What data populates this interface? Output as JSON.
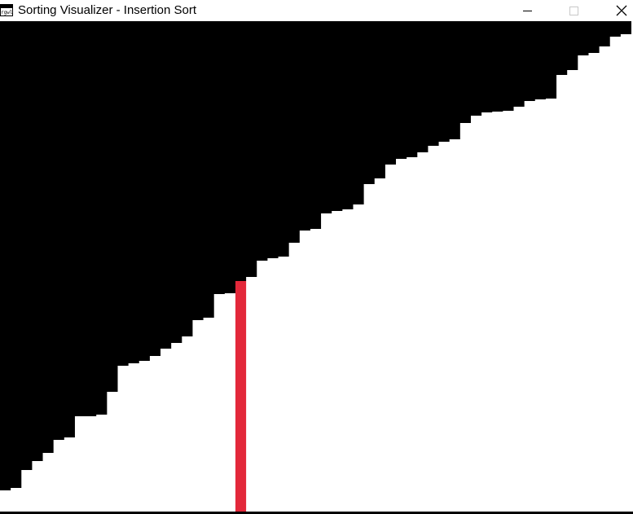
{
  "window": {
    "title": "Sorting Visualizer - Insertion Sort",
    "icon": "app-icon",
    "icon_text": "rgwlt",
    "controls": {
      "minimize": "minimize-icon",
      "maximize": "maximize-icon",
      "close": "close-icon",
      "close_glyph": "✕"
    }
  },
  "colors": {
    "background": "#000000",
    "bar": "#ffffff",
    "highlight": "#e3283a"
  },
  "visualizer": {
    "algorithm": "Insertion Sort",
    "max_value": 603,
    "current_index": 22,
    "values": [
      27,
      30,
      52,
      63,
      73,
      89,
      92,
      118,
      118,
      120,
      148,
      180,
      183,
      186,
      192,
      201,
      208,
      216,
      236,
      239,
      268,
      269,
      284,
      289,
      309,
      312,
      314,
      331,
      346,
      348,
      367,
      370,
      372,
      378,
      403,
      410,
      427,
      434,
      436,
      442,
      450,
      455,
      458,
      478,
      487,
      491,
      492,
      493,
      498,
      505,
      507,
      508,
      537,
      543,
      561,
      564,
      572,
      584,
      587
    ]
  }
}
